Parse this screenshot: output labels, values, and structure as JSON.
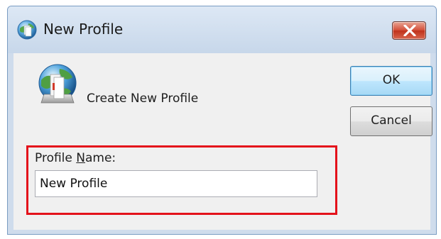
{
  "window": {
    "title": "New Profile",
    "icon": "profile-globe-icon",
    "close_icon": "close-icon"
  },
  "header": {
    "text": "Create New Profile",
    "icon": "profile-globe-icon"
  },
  "buttons": {
    "ok_label": "OK",
    "cancel_label": "Cancel"
  },
  "profile_name": {
    "label_before": "Profile ",
    "label_accel": "N",
    "label_after": "ame:",
    "value": "New Profile"
  },
  "colors": {
    "highlight": "#e4121b",
    "close_button": "#c0321b",
    "ok_border": "#3c7fb1"
  }
}
